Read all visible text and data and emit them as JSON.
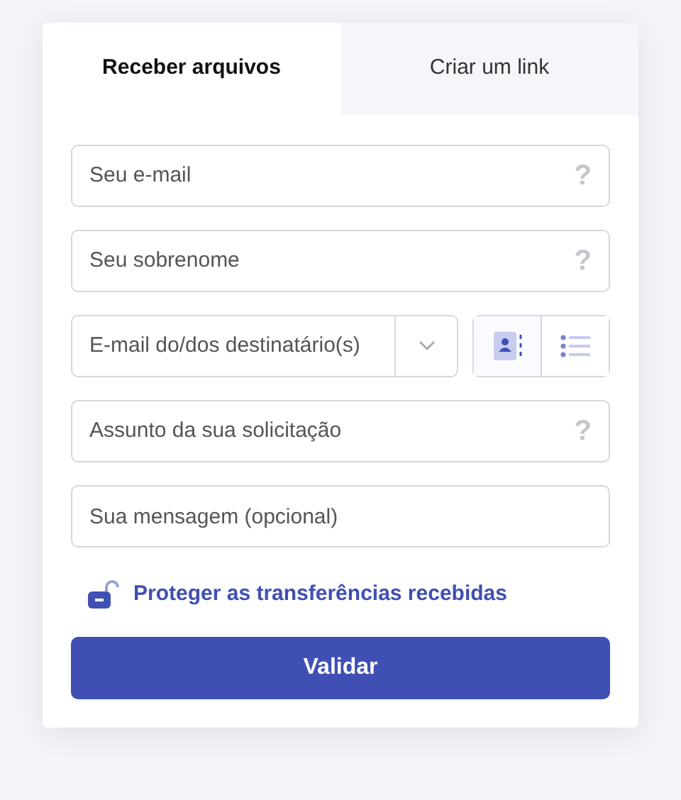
{
  "tabs": [
    {
      "label": "Receber arquivos",
      "selected": true
    },
    {
      "label": "Criar um link",
      "selected": false
    }
  ],
  "fields": [
    {
      "kind": "text",
      "placeholder": "Seu e-mail",
      "help": "?"
    },
    {
      "kind": "text",
      "placeholder": "Seu sobrenome",
      "help": "?"
    },
    {
      "kind": "recipients",
      "placeholder": "E-mail do/dos destinatário(s)",
      "modes": [
        {
          "kind": "contacts",
          "selected": true
        },
        {
          "kind": "list",
          "selected": false
        }
      ]
    },
    {
      "kind": "text",
      "placeholder": "Assunto da sua solicitação",
      "help": "?"
    },
    {
      "kind": "text",
      "placeholder": "Sua mensagem (opcional)"
    }
  ],
  "protect_link": "Proteger as transferências recebidas",
  "submit": "Validar"
}
